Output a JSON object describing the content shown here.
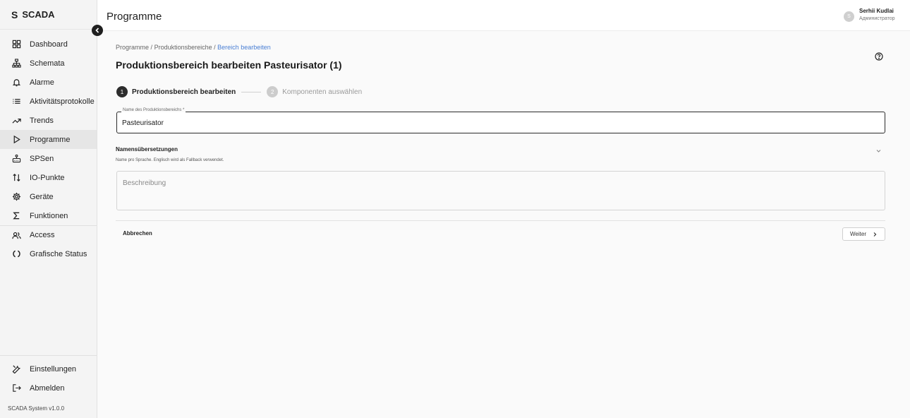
{
  "app": {
    "logo": "S",
    "name": "SCADA",
    "version": "SCADA System v1.0.0"
  },
  "sidebar": {
    "items": [
      {
        "label": "Dashboard",
        "icon": "dashboard-icon"
      },
      {
        "label": "Schemata",
        "icon": "sitemap-icon"
      },
      {
        "label": "Alarme",
        "icon": "bell-icon"
      },
      {
        "label": "Aktivitätsprotokolle",
        "icon": "list-icon"
      },
      {
        "label": "Trends",
        "icon": "trend-icon"
      },
      {
        "label": "Programme",
        "icon": "play-icon",
        "active": true
      },
      {
        "label": "SPSen",
        "icon": "plc-icon"
      },
      {
        "label": "IO-Punkte",
        "icon": "io-icon"
      },
      {
        "label": "Geräte",
        "icon": "gear-icon"
      },
      {
        "label": "Funktionen",
        "icon": "sigma-icon"
      },
      {
        "label": "Access",
        "icon": "users-icon"
      },
      {
        "label": "Grafische Status",
        "icon": "status-icon"
      }
    ],
    "bottom": [
      {
        "label": "Einstellungen",
        "icon": "wrench-icon"
      },
      {
        "label": "Abmelden",
        "icon": "logout-icon"
      }
    ]
  },
  "header": {
    "title": "Programme",
    "user": {
      "initial": "S",
      "name": "Serhii Kudlai",
      "role": "Администратор"
    }
  },
  "breadcrumb": {
    "items": [
      "Programme",
      "Produktionsbereiche"
    ],
    "separator": "/",
    "current": "Bereich bearbeiten"
  },
  "page": {
    "title": "Produktionsbereich bearbeiten Pasteurisator (1)"
  },
  "stepper": {
    "steps": [
      {
        "number": "1",
        "label": "Produktionsbereich bearbeiten",
        "active": true
      },
      {
        "number": "2",
        "label": "Komponenten auswählen",
        "active": false
      }
    ]
  },
  "form": {
    "name_label": "Name des Produktionsbereichs *",
    "name_value": "Pasteurisator",
    "translations_title": "Namensübersetzungen",
    "translations_hint": "Name pro Sprache. Englisch wird als Fallback verwendet.",
    "description_placeholder": "Beschreibung"
  },
  "actions": {
    "cancel": "Abbrechen",
    "next": "Weiter"
  },
  "colors": {
    "accent_link": "#4a7fd4",
    "active_step": "#2d2d2d",
    "inactive_step": "#cccccc"
  }
}
